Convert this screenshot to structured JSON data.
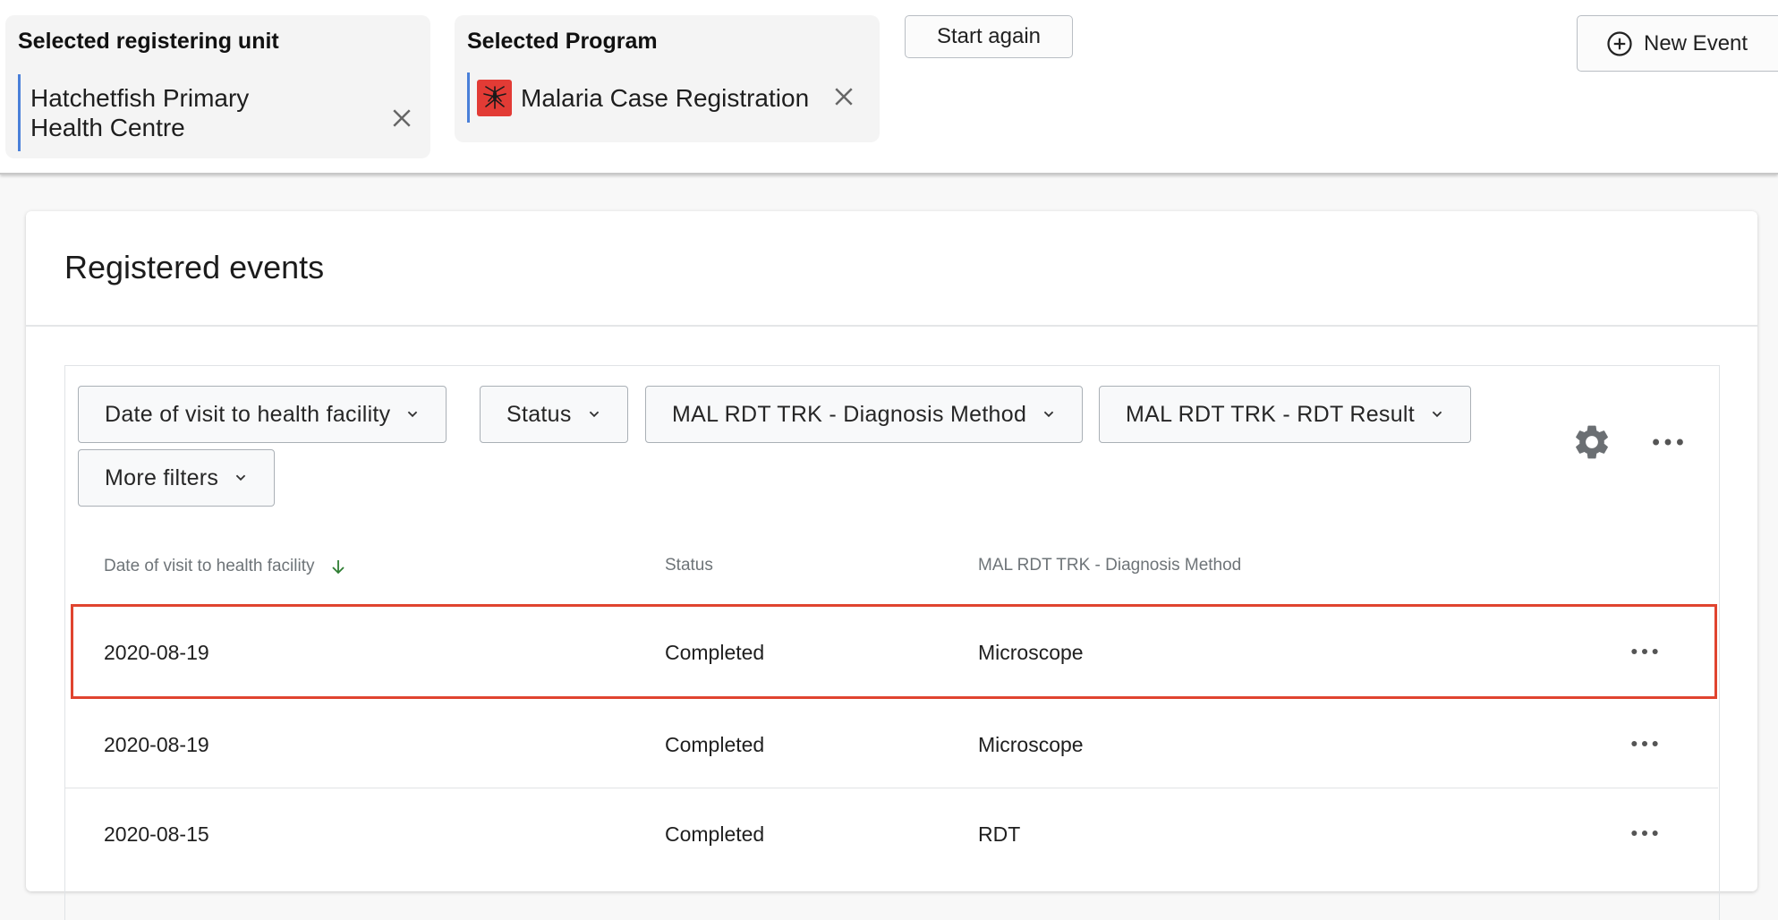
{
  "context": {
    "orgunit": {
      "title": "Selected registering unit",
      "value": "Hatchetfish Primary Health Centre"
    },
    "program": {
      "title": "Selected Program",
      "value": "Malaria Case Registration",
      "icon": "mosquito-icon",
      "icon_color": "#e23b35"
    },
    "start_again_label": "Start again",
    "new_event_label": "New Event"
  },
  "main": {
    "title": "Registered events",
    "filters": [
      "Date of visit to health facility",
      "Status",
      "MAL RDT TRK - Diagnosis Method",
      "MAL RDT TRK - RDT Result",
      "More filters"
    ],
    "columns": [
      "Date of visit to health facility",
      "Status",
      "MAL RDT TRK - Diagnosis Method"
    ],
    "sort_icon": "arrow-down-icon",
    "rows": [
      {
        "date": "2020-08-19",
        "status": "Completed",
        "method": "Microscope",
        "highlighted": true
      },
      {
        "date": "2020-08-19",
        "status": "Completed",
        "method": "Microscope",
        "highlighted": false
      },
      {
        "date": "2020-08-15",
        "status": "Completed",
        "method": "RDT",
        "highlighted": false
      }
    ]
  },
  "colors": {
    "accent_border": "#4a80d9",
    "highlight": "#e0442f",
    "sort_arrow": "#2e7d32"
  }
}
